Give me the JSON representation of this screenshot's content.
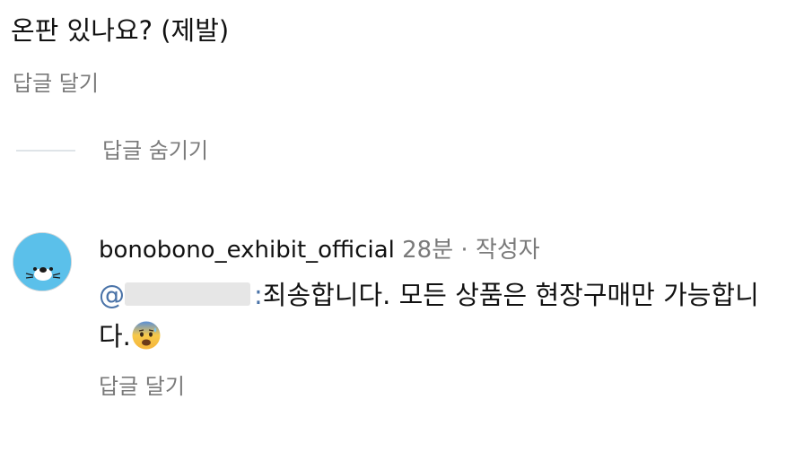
{
  "top_comment": {
    "text": "온판 있나요? (제발)",
    "reply_label": "답글 달기"
  },
  "hide_replies": {
    "label": "답글 숨기기"
  },
  "reply": {
    "username": "bonobono_exhibit_official",
    "time": "28분",
    "separator": "·",
    "author_tag": "작성자",
    "mention_prefix": "@",
    "mention_suffix": ":",
    "text": "죄송합니다. 모든 상품은 현장구매만 가능합니다.",
    "emoji": "anxious-face-with-sweat-icon",
    "reply_label": "답글 달기"
  },
  "colors": {
    "muted_text": "#7a7a7a",
    "mention": "#4a73a8",
    "avatar_bg": "#5bc0ea"
  }
}
